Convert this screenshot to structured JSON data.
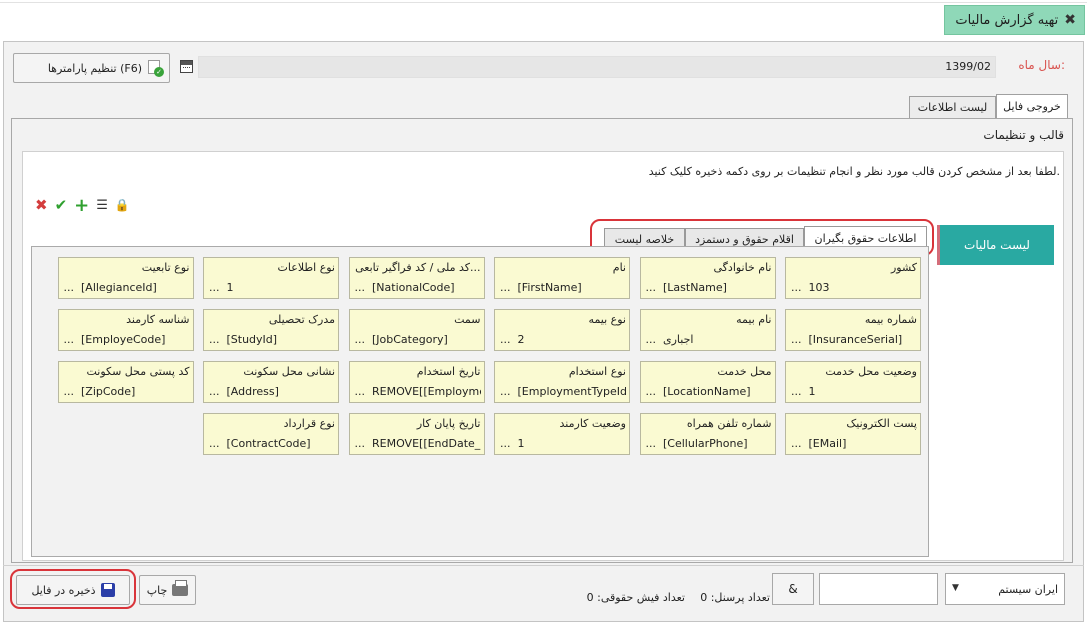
{
  "page_tab": {
    "title": "تهیه گزارش مالیات"
  },
  "params": {
    "button_label": "تنظیم پارامترها (F6)"
  },
  "month": {
    "label": "سال ماه:",
    "value": "1399/02"
  },
  "tabs": {
    "output": "خروجی فایل",
    "info_list": "لیست اطلاعات"
  },
  "section_title": "قالب و تنظیمات",
  "instruction": "لطفا بعد از مشخص کردن قالب مورد نظر و انجام تنظیمات بر روی دکمه ذخیره کلیک کنید.",
  "side_tab": "لیست مالیات",
  "subtabs": [
    "اطلاعات حقوق بگیران",
    "اقلام حقوق و دستمزد",
    "خلاصه لیست"
  ],
  "fields": [
    {
      "label": "کشور",
      "value": "103"
    },
    {
      "label": "نام خانوادگی",
      "value": "[LastName]"
    },
    {
      "label": "نام",
      "value": "[FirstName]"
    },
    {
      "label": "کد ملی / کد فراگیر تابعی...",
      "value": "[NationalCode]"
    },
    {
      "label": "نوع اطلاعات",
      "value": "1"
    },
    {
      "label": "نوع تابعیت",
      "value": "[AllegianceId]"
    },
    {
      "label": "شماره بیمه",
      "value": "[InsuranceSerial]"
    },
    {
      "label": "نام بیمه",
      "value": "اجباری"
    },
    {
      "label": "نوع بیمه",
      "value": "2"
    },
    {
      "label": "سمت",
      "value": "[JobCategory]"
    },
    {
      "label": "مدرک تحصیلی",
      "value": "[StudyId]"
    },
    {
      "label": "شناسه کارمند",
      "value": "[EmployeCode]"
    },
    {
      "label": "وضعیت محل خدمت",
      "value": "1"
    },
    {
      "label": "محل خدمت",
      "value": "[LocationName]"
    },
    {
      "label": "نوع استخدام",
      "value": "[EmploymentTypeId]"
    },
    {
      "label": "تاریخ استخدام",
      "value": "REMOVE[[Employme"
    },
    {
      "label": "نشانی محل سکونت",
      "value": "[Address]"
    },
    {
      "label": "کد پستی محل سکونت",
      "value": "[ZipCode]"
    },
    {
      "label": "پست الکترونیک",
      "value": "[EMail]"
    },
    {
      "label": "شماره تلفن همراه",
      "value": "[CellularPhone]"
    },
    {
      "label": "وضعیت کارمند",
      "value": "1"
    },
    {
      "label": "تاریخ پایان کار",
      "value": "REMOVE[[EndDate_S"
    },
    {
      "label": "نوع قرارداد",
      "value": "[ContractCode]"
    }
  ],
  "ellipsis": "...",
  "bottom": {
    "combo_value": "ایران سیستم",
    "amp_label": "&",
    "personnel_count": "تعداد پرسنل: 0",
    "slip_count": "تعداد فیش حقوقی: 0",
    "print_label": "چاپ",
    "save_label": "ذخیره در فایل"
  }
}
